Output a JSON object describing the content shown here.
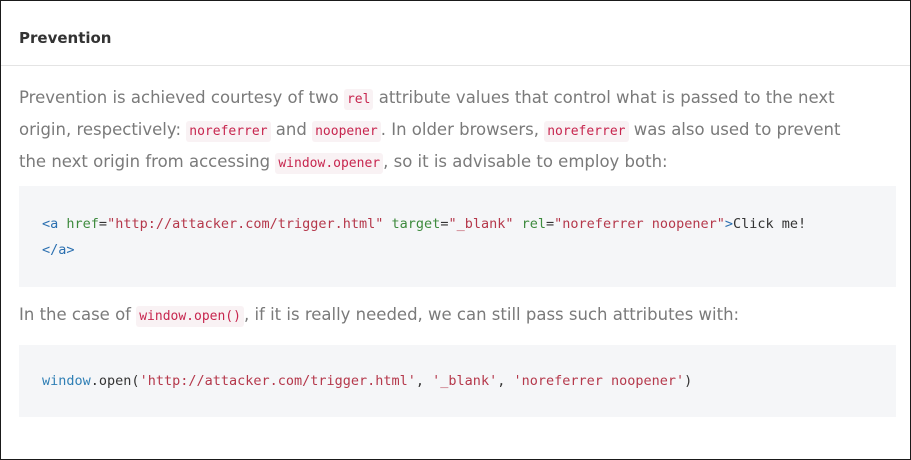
{
  "heading": "Prevention",
  "paragraph1": {
    "t1": "Prevention is achieved courtesy of two ",
    "c1": "rel",
    "t2": " attribute values that control what is passed to the next",
    "t3": "origin, respectively: ",
    "c2": "noreferrer",
    "t4": " and ",
    "c3": "noopener",
    "t5": ". In older browsers, ",
    "c4": "noreferrer",
    "t6": " was also used to prevent",
    "t7": "the next origin from accessing ",
    "c5": "window.opener",
    "t8": ", so it is advisable to employ both:"
  },
  "code_block1": {
    "open_tag": "<a",
    "href_attr": "href",
    "eq1": "=",
    "href_val": "\"http://attacker.com/trigger.html\"",
    "target_attr": "target",
    "eq2": "=",
    "target_val": "\"_blank\"",
    "rel_attr": "rel",
    "eq3": "=",
    "rel_val": "\"noreferrer noopener\"",
    "gt": ">",
    "text": "Click me!",
    "close_tag": "</a>"
  },
  "paragraph2": {
    "t1": "In the case of ",
    "c1": "window.open()",
    "t2": ", if it is really needed, we can still pass such attributes with:"
  },
  "code_block2": {
    "obj": "window",
    "dot": ".",
    "method": "open(",
    "arg1": "'http://attacker.com/trigger.html'",
    "sep1": ", ",
    "arg2": "'_blank'",
    "sep2": ", ",
    "arg3": "'noreferrer noopener'",
    "close": ")"
  },
  "colors": {
    "inline_code_text": "#c7254e",
    "inline_code_bg": "#f9f2f4",
    "code_bg": "#f5f6f8",
    "body_text": "#7a7a7a",
    "heading_text": "#333333"
  }
}
